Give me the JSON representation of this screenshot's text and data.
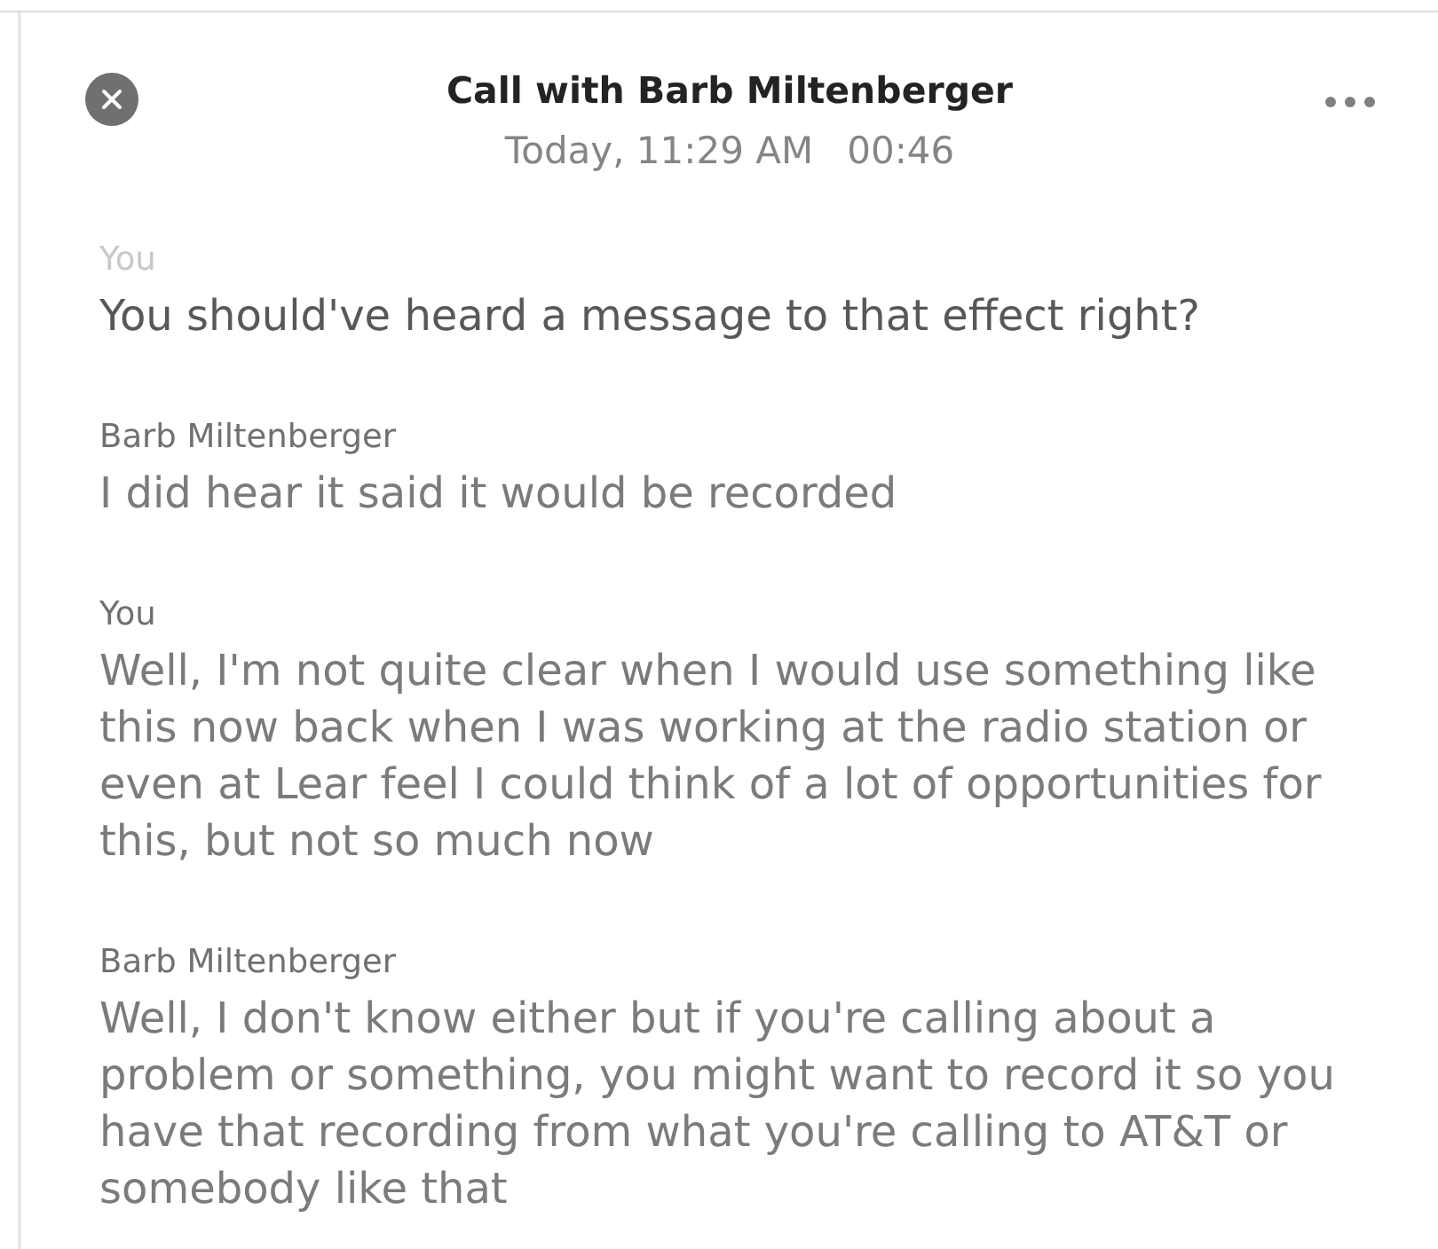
{
  "call": {
    "title": "Call with Barb Miltenberger",
    "date": "Today, 11:29 AM",
    "duration": "00:46"
  },
  "transcript": [
    {
      "speaker": "You",
      "text": "You should've heard a message to that effect right?",
      "current": true
    },
    {
      "speaker": "Barb Miltenberger",
      "text": "I did hear it said it would be recorded",
      "current": false
    },
    {
      "speaker": "You",
      "text": "Well, I'm not quite clear when I would use something like this now back when I was working at the radio station or even at Lear feel I could think of a lot of opportunities for this, but not so much now",
      "current": false
    },
    {
      "speaker": "Barb Miltenberger",
      "text": "Well, I don't know either but if you're calling about a problem or something, you might want to record it so you have that recording from what you're calling to AT&T or somebody like that",
      "current": false
    }
  ]
}
